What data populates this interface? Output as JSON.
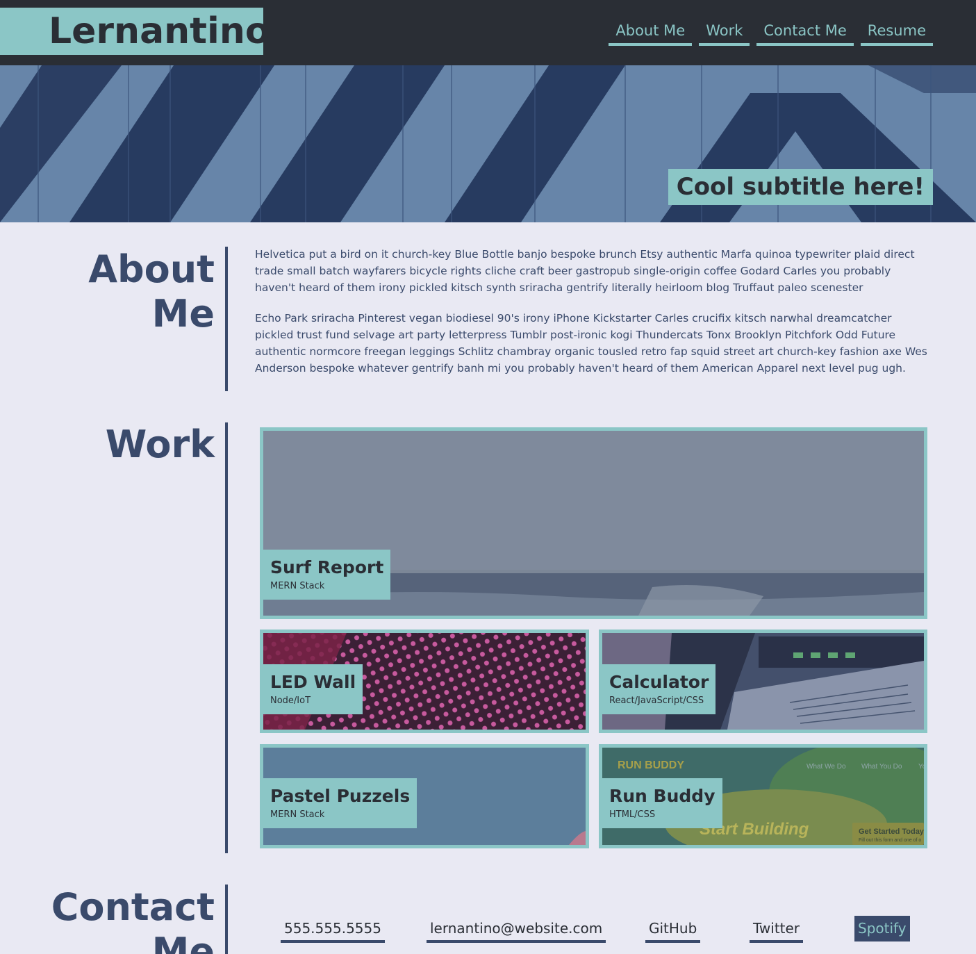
{
  "brand": "Lernantino",
  "nav": [
    "About Me",
    "Work",
    "Contact Me",
    "Resume"
  ],
  "hero": {
    "subtitle": "Cool subtitle here!"
  },
  "about": {
    "title_line1": "About",
    "title_line2": "Me",
    "paragraphs": [
      "Helvetica put a bird on it church-key Blue Bottle banjo bespoke brunch Etsy authentic Marfa quinoa typewriter plaid direct trade small batch wayfarers bicycle rights cliche craft beer gastropub single-origin coffee Godard Carles you probably haven't heard of them irony pickled kitsch synth sriracha gentrify literally heirloom blog Truffaut paleo scenester",
      "Echo Park sriracha Pinterest vegan biodiesel 90's irony iPhone Kickstarter Carles crucifix kitsch narwhal dreamcatcher pickled trust fund selvage art party letterpress Tumblr post-ironic kogi Thundercats Tonx Brooklyn Pitchfork Odd Future authentic normcore freegan leggings Schlitz chambray organic tousled retro fap squid street art church-key fashion axe Wes Anderson bespoke whatever gentrify banh mi you probably haven't heard of them American Apparel next level pug ugh."
    ]
  },
  "work": {
    "title": "Work",
    "projects": [
      {
        "name": "Surf Report",
        "stack": "MERN Stack"
      },
      {
        "name": "LED Wall",
        "stack": "Node/IoT"
      },
      {
        "name": "Calculator",
        "stack": "React/JavaScript/CSS"
      },
      {
        "name": "Pastel Puzzels",
        "stack": "MERN Stack"
      },
      {
        "name": "Run Buddy",
        "stack": "HTML/CSS"
      }
    ],
    "run_buddy_screenshot": {
      "logo": "RUN BUDDY",
      "nav": [
        "What We Do",
        "What You Do",
        "Yo"
      ],
      "headline": "Start Building",
      "cta_title": "Get Started Today",
      "cta_text": "Fill out this form and one of o"
    }
  },
  "contact": {
    "title_line1": "Contact",
    "title_line2": "Me",
    "links": [
      "555.555.5555",
      "lernantino@website.com",
      "GitHub",
      "Twitter",
      "Spotify"
    ]
  },
  "colors": {
    "accent": "#8bc6c6",
    "dark": "#2a2e35",
    "navy": "#3a4a6b",
    "page_bg": "#e9e9f3"
  }
}
